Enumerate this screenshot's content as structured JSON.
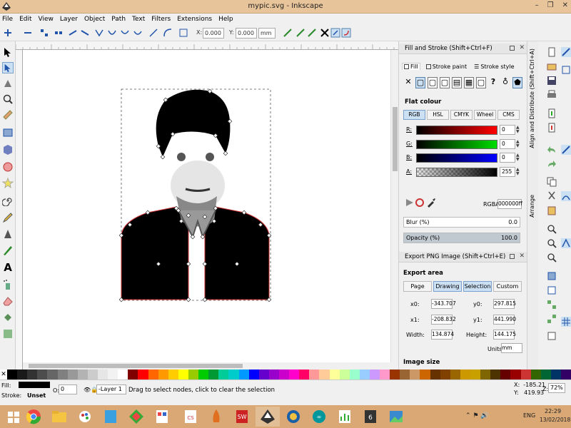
{
  "window": {
    "title": "mypic.svg - Inkscape",
    "controls": [
      "–",
      "❐",
      "✕"
    ]
  },
  "menu": [
    "File",
    "Edit",
    "View",
    "Layer",
    "Object",
    "Path",
    "Text",
    "Filters",
    "Extensions",
    "Help"
  ],
  "toolbar": {
    "x_label": "X:",
    "x_value": "0.000",
    "y_label": "Y:",
    "y_value": "0.000",
    "unit": "mm"
  },
  "fill_stroke": {
    "title": "Fill and Stroke (Shift+Ctrl+F)",
    "tabs": [
      "Fill",
      "Stroke paint",
      "Stroke style"
    ],
    "flat_colour": "Flat colour",
    "modes": [
      "RGB",
      "HSL",
      "CMYK",
      "Wheel",
      "CMS"
    ],
    "channels": [
      {
        "label": "R:",
        "value": "0",
        "color": "#ff0000"
      },
      {
        "label": "G:",
        "value": "0",
        "color": "#00cc00"
      },
      {
        "label": "B:",
        "value": "0",
        "color": "#0000ff"
      },
      {
        "label": "A:",
        "value": "255",
        "color": "#000000"
      }
    ],
    "rgba_label": "RGBA:",
    "rgba_value": "000000ff",
    "blur_label": "Blur (%)",
    "blur_value": "0.0",
    "opacity_label": "Opacity (%)",
    "opacity_value": "100.0"
  },
  "export": {
    "title": "Export PNG Image (Shift+Ctrl+E)",
    "area_heading": "Export area",
    "area_buttons": [
      "Page",
      "Drawing",
      "Selection",
      "Custom"
    ],
    "x0_label": "x0:",
    "x0": "-343.707",
    "y0_label": "y0:",
    "y0": "297.815",
    "x1_label": "x1:",
    "x1": "-208.832",
    "y1_label": "y1:",
    "y1": "441.990",
    "width_label": "Width:",
    "width": "134.874",
    "height_label": "Height:",
    "height": "144.175",
    "units_label": "Units:",
    "units": "mm",
    "image_size": "Image size"
  },
  "side_tabs": {
    "align": "Align and Distribute (Shift+Ctrl+A)",
    "arrange": "Arrange"
  },
  "status": {
    "fill_label": "Fill:",
    "stroke_label": "Stroke:",
    "stroke_value": "Unset",
    "o_label": "O:",
    "o_value": "0",
    "layer": "-Layer 1",
    "message": "Drag to select nodes, click to clear the selection",
    "x_coord": "X:  -185.21",
    "y_coord": "Y:   419.93",
    "z_label": "Z:",
    "zoom": "72%"
  },
  "taskbar": {
    "time": "22:29",
    "date": "13/02/2018",
    "lang": "ENG"
  },
  "palette": [
    "#000000",
    "#1a1a1a",
    "#333333",
    "#4d4d4d",
    "#666666",
    "#808080",
    "#999999",
    "#b3b3b3",
    "#cccccc",
    "#e6e6e6",
    "#f2f2f2",
    "#ffffff",
    "#800000",
    "#ff0000",
    "#ff6600",
    "#ff9900",
    "#ffcc00",
    "#ffff00",
    "#99cc00",
    "#00cc00",
    "#009933",
    "#00cc99",
    "#00cccc",
    "#0099ff",
    "#0000ff",
    "#6600cc",
    "#9900cc",
    "#cc00cc",
    "#ff00cc",
    "#ff0066",
    "#ff9999",
    "#ffcc99",
    "#ffff99",
    "#ccff99",
    "#99ffcc",
    "#99ccff",
    "#cc99ff",
    "#ff99cc",
    "#993300",
    "#996633",
    "#cc9966",
    "#cc6600",
    "#663300",
    "#804000",
    "#996600",
    "#cc9900",
    "#c8a000",
    "#806600",
    "#4d3300",
    "#660000",
    "#990000",
    "#cc3333",
    "#336600",
    "#006633",
    "#003366",
    "#330066"
  ],
  "colors": {
    "titlebar": "#e8c49a",
    "taskbar": "#d9a875",
    "accent": "#cce0f4"
  }
}
